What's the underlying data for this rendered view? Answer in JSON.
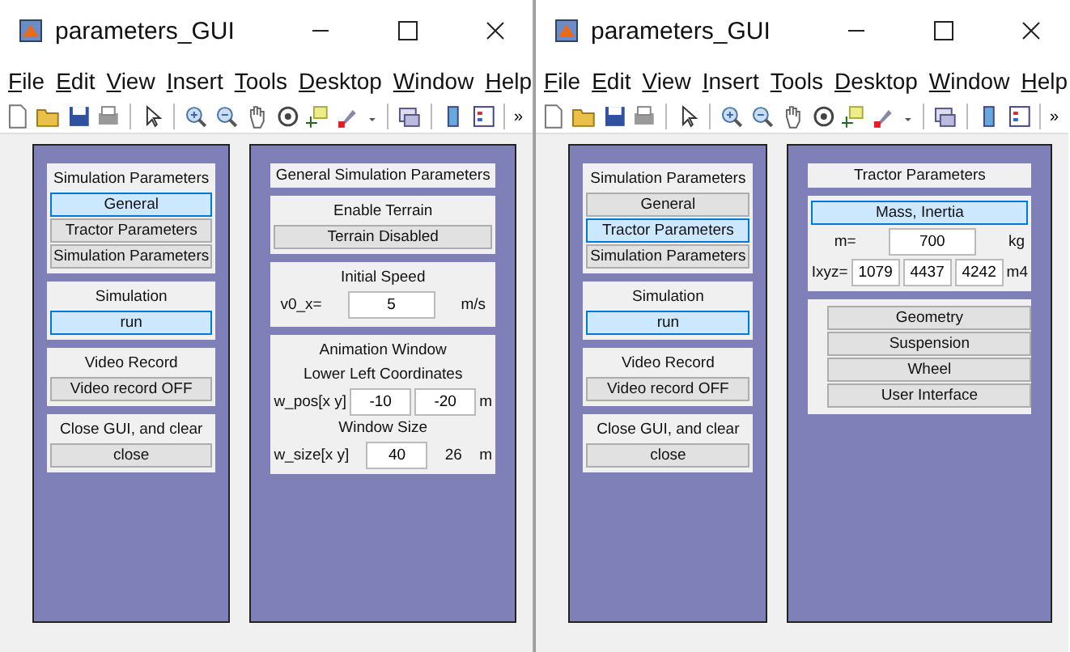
{
  "windows": [
    {
      "title": "parameters_GUI",
      "menu": [
        "File",
        "Edit",
        "View",
        "Insert",
        "Tools",
        "Desktop",
        "Window",
        "Help"
      ],
      "toolbar_overflow": "»",
      "left_panel": [
        {
          "heading": "Simulation Parameters",
          "buttons": [
            {
              "label": "General",
              "selected": true
            },
            {
              "label": "Tractor Parameters",
              "selected": false
            },
            {
              "label": "Simulation Parameters",
              "selected": false
            }
          ]
        },
        {
          "heading": "Simulation",
          "buttons": [
            {
              "label": "run",
              "selected": true
            }
          ]
        },
        {
          "heading": "Video Record",
          "buttons": [
            {
              "label": "Video record OFF",
              "selected": false
            }
          ]
        },
        {
          "heading": "Close GUI, and clear",
          "buttons": [
            {
              "label": "close",
              "selected": false
            }
          ]
        }
      ],
      "right_panel": {
        "title": "General Simulation Parameters",
        "sections": [
          {
            "kind": "toggle",
            "heading": "Enable Terrain",
            "button": {
              "label": "Terrain Disabled",
              "selected": false
            }
          },
          {
            "kind": "speed",
            "heading": "Initial Speed",
            "label": "v0_x=",
            "value": "5",
            "unit": "m/s"
          },
          {
            "kind": "animation",
            "heading": "Animation Window",
            "subheading": "Lower Left Coordinates",
            "pos_label": "w_pos[x y]",
            "pos_values": [
              "-10",
              "-20"
            ],
            "pos_unit": "m",
            "size_heading": "Window Size",
            "size_label": "w_size[x y]",
            "size_value": "40",
            "size_text": "26",
            "size_unit": "m"
          }
        ]
      }
    },
    {
      "title": "parameters_GUI",
      "menu": [
        "File",
        "Edit",
        "View",
        "Insert",
        "Tools",
        "Desktop",
        "Window",
        "Help"
      ],
      "toolbar_overflow": "»",
      "left_panel": [
        {
          "heading": "Simulation Parameters",
          "buttons": [
            {
              "label": "General",
              "selected": false
            },
            {
              "label": "Tractor Parameters",
              "selected": true
            },
            {
              "label": "Simulation Parameters",
              "selected": false
            }
          ]
        },
        {
          "heading": "Simulation",
          "buttons": [
            {
              "label": "run",
              "selected": true
            }
          ]
        },
        {
          "heading": "Video Record",
          "buttons": [
            {
              "label": "Video record OFF",
              "selected": false
            }
          ]
        },
        {
          "heading": "Close GUI, and clear",
          "buttons": [
            {
              "label": "close",
              "selected": false
            }
          ]
        }
      ],
      "right_panel": {
        "title": "Tractor Parameters",
        "sections": [
          {
            "kind": "mass",
            "button": {
              "label": "Mass, Inertia",
              "selected": true
            },
            "m_label": "m=",
            "m_value": "700",
            "m_unit": "kg",
            "i_label": "Ixyz=",
            "i_values": [
              "1079",
              "4437",
              "4242"
            ],
            "i_unit": "m4"
          },
          {
            "kind": "buttons",
            "buttons": [
              {
                "label": "Geometry",
                "selected": false
              },
              {
                "label": "Suspension",
                "selected": false
              },
              {
                "label": "Wheel",
                "selected": false
              },
              {
                "label": "User Interface",
                "selected": false
              }
            ]
          }
        ]
      }
    }
  ]
}
